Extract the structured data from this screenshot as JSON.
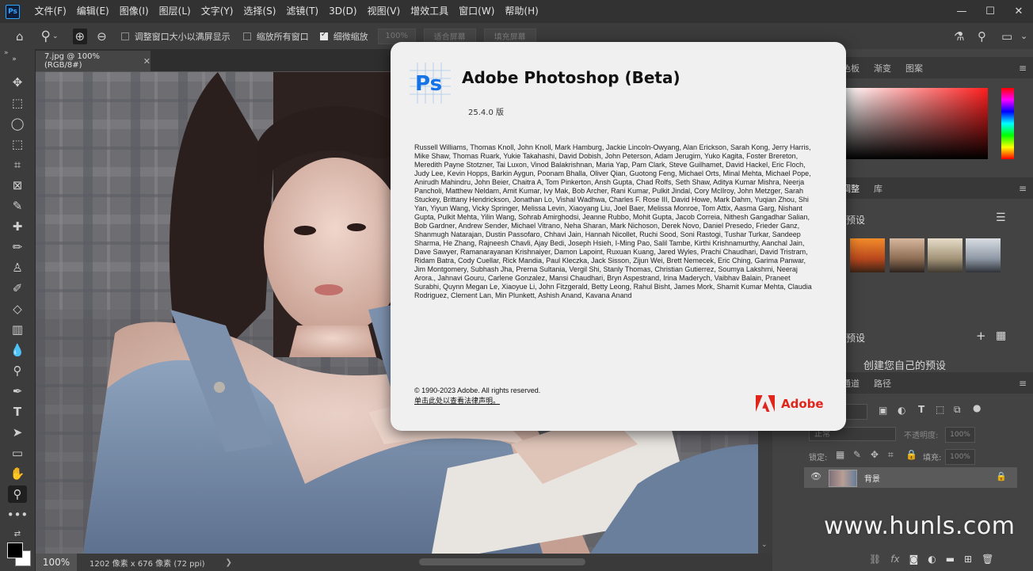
{
  "app": {
    "logo_text": "Ps"
  },
  "menubar": {
    "items": [
      "文件(F)",
      "编辑(E)",
      "图像(I)",
      "图层(L)",
      "文字(Y)",
      "选择(S)",
      "滤镜(T)",
      "3D(D)",
      "视图(V)",
      "增效工具",
      "窗口(W)",
      "帮助(H)"
    ],
    "window_controls": {
      "minimize": "—",
      "restore": "☐",
      "close": "✕"
    }
  },
  "options_bar": {
    "resize_windows_label": "调整窗口大小以满屏显示",
    "zoom_all_label": "缩放所有窗口",
    "scrubby_zoom_label": "细微缩放",
    "zoom_value": "100%",
    "fit_screen_label": "适合屏幕",
    "fill_screen_label": "填充屏幕",
    "resize_windows_checked": false,
    "zoom_all_checked": false,
    "scrubby_zoom_checked": true
  },
  "document": {
    "tab_title": "7.jpg @ 100%(RGB/8#)",
    "close": "✕"
  },
  "status_bar": {
    "zoom": "100%",
    "info": "1202 像素 x 676 像素 (72 ppi)",
    "arrow": "❯"
  },
  "right_panels": {
    "color_tabs": [
      "色板",
      "渐变",
      "图案"
    ],
    "adjust_tabs": [
      "调整",
      "库"
    ],
    "presets_label": "预设",
    "my_presets_label": "预设",
    "create_presets_text": "创建您自己的预设",
    "layers_tabs": [
      "通道",
      "路径"
    ],
    "blend_mode": "正常",
    "opacity_label": "不透明度:",
    "opacity_value": "100%",
    "lock_label": "锁定:",
    "fill_label": "填充:",
    "fill_value": "100%",
    "layer_name": "背景"
  },
  "about": {
    "logo_text": "Ps",
    "title": "Adobe Photoshop (Beta)",
    "version": "25.4.0 版",
    "credits": "Russell Williams, Thomas Knoll, John Knoll, Mark Hamburg, Jackie Lincoln-Owyang, Alan Erickson, Sarah Kong, Jerry Harris, Mike Shaw, Thomas Ruark, Yukie Takahashi, David Dobish, John Peterson, Adam Jerugim, Yuko Kagita, Foster Brereton, Meredith Payne Stotzner, Tai Luxon, Vinod Balakrishnan, Maria Yap, Pam Clark, Steve Guilhamet, David Hackel, Eric Floch, Judy Lee, Kevin Hopps, Barkin Aygun, Poonam Bhalla, Oliver Qian, Guotong Feng, Michael Orts, Minal Mehta, Michael Pope, Anirudh Mahindru, John Beier, Chaitra A, Tom Pinkerton, Ansh Gupta, Chad Rolfs, Seth Shaw, Aditya Kumar Mishra, Neerja Pancholi, Matthew Neldam, Amit Kumar, Ivy Mak, Bob Archer, Rani Kumar, Pulkit Jindal, Cory McIlroy, John Metzger, Sarah Stuckey, Brittany Hendrickson, Jonathan Lo, Vishal Wadhwa, Charles F. Rose III, David Howe, Mark Dahm, Yuqian Zhou, Shi Yan, Yiyun Wang, Vicky Springer, Melissa Levin, Xiaoyang Liu, Joel Baer, Melissa Monroe, Tom Attix, Aasma Garg, Nishant Gupta, Pulkit Mehta, Yilin Wang, Sohrab Amirghodsi, Jeanne Rubbo, Mohit Gupta, Jacob Correia, Nithesh Gangadhar Salian, Bob Gardner, Andrew Sender, Michael Vitrano, Neha Sharan, Mark Nichoson, Derek Novo, Daniel Presedo, Frieder Ganz, Shanmugh Natarajan, Dustin Passofaro, Chhavi Jain, Hannah Nicollet, Ruchi Sood, Soni Rastogi, Tushar Turkar, Sandeep Sharma, He Zhang, Rajneesh Chavli, Ajay Bedi, Joseph Hsieh, I-Ming Pao, Salil Tambe, Kirthi Krishnamurthy, Aanchal Jain, Dave Sawyer, Ramanarayanan Krishnaiyer, Damon Lapoint, Ruxuan Kuang, Jared Wyles, Prachi Chaudhari, David Tristram, Ridam Batra, Cody Cuellar, Rick Mandia, Paul Kleczka, Jack Sisson, Zijun Wei, Brett Nemecek, Eric Ching, Garima Panwar, Jim Montgomery, Subhash Jha, Prerna Sultania, Vergil Shi, Stanly Thomas, Christian Gutierrez, Soumya Lakshmi, Neeraj Arora., Jahnavi Gouru, Carlene Gonzalez, Mansi Chaudhari, Bryn Aspestrand, Irina Maderych, Vaibhav Balain, Praneet Surabhi, Quynn Megan Le, Xiaoyue Li, John Fitzgerald, Betty Leong, Rahul Bisht, James Mork, Shamit Kumar Mehta, Claudia Rodriguez, Clement Lan, Min Plunkett, Ashish Anand, Kavana Anand",
    "copyright": "© 1990-2023 Adobe. All rights reserved.",
    "legal_link": "单击此处以查看法律声明。",
    "brand": "Adobe"
  },
  "watermark": "www.hunls.com",
  "colors": {
    "accent": "#31a8ff",
    "adobe_red": "#e1251b",
    "menubar_bg": "#323232",
    "panel_bg": "#434343"
  }
}
